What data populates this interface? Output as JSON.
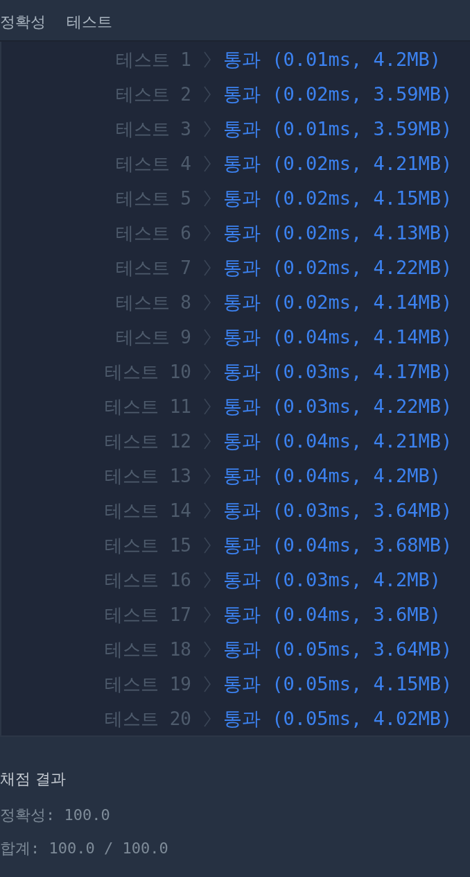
{
  "header": {
    "tabs": [
      "정확성",
      "테스트"
    ]
  },
  "tests": [
    {
      "label": "테스트 1",
      "result": "통과 (0.01ms, 4.2MB)"
    },
    {
      "label": "테스트 2",
      "result": "통과 (0.02ms, 3.59MB)"
    },
    {
      "label": "테스트 3",
      "result": "통과 (0.01ms, 3.59MB)"
    },
    {
      "label": "테스트 4",
      "result": "통과 (0.02ms, 4.21MB)"
    },
    {
      "label": "테스트 5",
      "result": "통과 (0.02ms, 4.15MB)"
    },
    {
      "label": "테스트 6",
      "result": "통과 (0.02ms, 4.13MB)"
    },
    {
      "label": "테스트 7",
      "result": "통과 (0.02ms, 4.22MB)"
    },
    {
      "label": "테스트 8",
      "result": "통과 (0.02ms, 4.14MB)"
    },
    {
      "label": "테스트 9",
      "result": "통과 (0.04ms, 4.14MB)"
    },
    {
      "label": "테스트 10",
      "result": "통과 (0.03ms, 4.17MB)"
    },
    {
      "label": "테스트 11",
      "result": "통과 (0.03ms, 4.22MB)"
    },
    {
      "label": "테스트 12",
      "result": "통과 (0.04ms, 4.21MB)"
    },
    {
      "label": "테스트 13",
      "result": "통과 (0.04ms, 4.2MB)"
    },
    {
      "label": "테스트 14",
      "result": "통과 (0.03ms, 3.64MB)"
    },
    {
      "label": "테스트 15",
      "result": "통과 (0.04ms, 3.68MB)"
    },
    {
      "label": "테스트 16",
      "result": "통과 (0.03ms, 4.2MB)"
    },
    {
      "label": "테스트 17",
      "result": "통과 (0.04ms, 3.6MB)"
    },
    {
      "label": "테스트 18",
      "result": "통과 (0.05ms, 3.64MB)"
    },
    {
      "label": "테스트 19",
      "result": "통과 (0.05ms, 4.15MB)"
    },
    {
      "label": "테스트 20",
      "result": "통과 (0.05ms, 4.02MB)"
    }
  ],
  "summary": {
    "title": "채점 결과",
    "lines": [
      "정확성: 100.0",
      "합계: 100.0 / 100.0"
    ]
  }
}
